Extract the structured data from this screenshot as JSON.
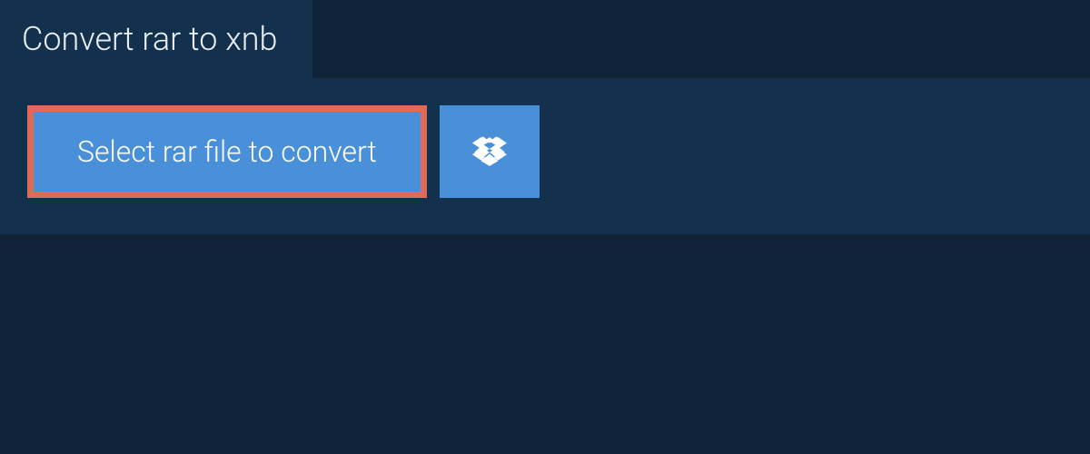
{
  "tab": {
    "title": "Convert rar to xnb"
  },
  "actions": {
    "select_label": "Select rar file to convert",
    "dropbox_icon": "dropbox-icon"
  }
}
